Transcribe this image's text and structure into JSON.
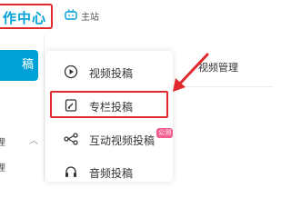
{
  "header": {
    "title": "作中心",
    "home_label": "主站"
  },
  "sidebar": {
    "upload_button": "稿",
    "items": [
      {
        "label": "理"
      },
      {
        "label": "理"
      }
    ]
  },
  "menu": {
    "items": [
      {
        "label": "视频投稿",
        "icon": "video-icon"
      },
      {
        "label": "专栏投稿",
        "icon": "article-icon"
      },
      {
        "label": "互动视频投稿",
        "icon": "interactive-icon"
      },
      {
        "label": "音频投稿",
        "icon": "audio-icon"
      }
    ],
    "badge": "公测"
  },
  "main": {
    "tab_label": "视频管理"
  },
  "colors": {
    "accent": "#00a1d6",
    "highlight": "#e0282d",
    "badge": "#f25d8e"
  }
}
